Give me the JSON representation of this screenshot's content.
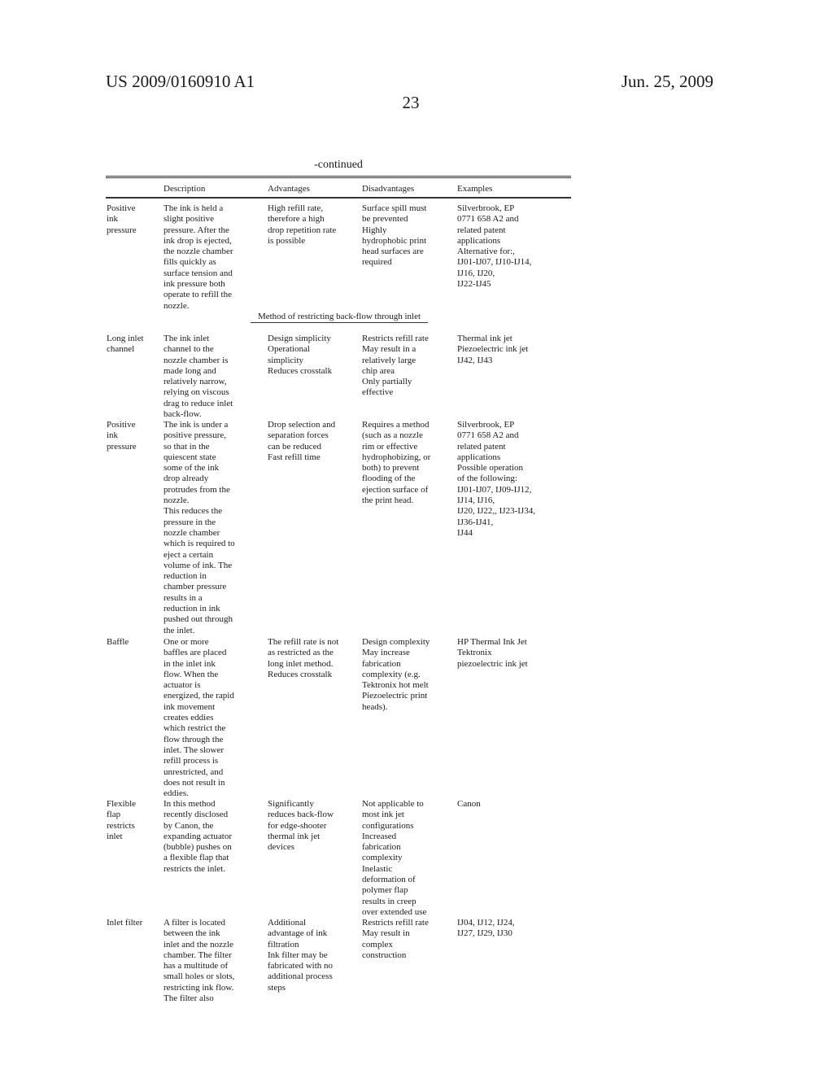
{
  "header": {
    "patent_number": "US 2009/0160910 A1",
    "date": "Jun. 25, 2009",
    "page_number": "23"
  },
  "table": {
    "continued_label": "-continued",
    "columns": [
      "",
      "Description",
      "Advantages",
      "Disadvantages",
      "Examples"
    ],
    "subheading": "Method of restricting back-flow through inlet",
    "rows": [
      {
        "name": "Positive\nink\npressure",
        "description": "The ink is held a\nslight positive\npressure. After the\nink drop is ejected,\nthe nozzle chamber\nfills quickly as\nsurface tension and\nink pressure both\noperate to refill the\nnozzle.",
        "advantages": "High refill rate,\ntherefore a high\ndrop repetition rate\nis possible",
        "disadvantages": "Surface spill must\nbe prevented\nHighly\nhydrophobic print\nhead surfaces are\nrequired",
        "examples": "Silverbrook, EP\n0771 658 A2 and\nrelated patent\napplications\nAlternative for:,\nIJ01-IJ07, IJ10-IJ14,\nIJ16, IJ20,\nIJ22-IJ45"
      },
      {
        "name": "Long inlet\nchannel",
        "description": "The ink inlet\nchannel to the\nnozzle chamber is\nmade long and\nrelatively narrow,\nrelying on viscous\ndrag to reduce inlet\nback-flow.",
        "advantages": "Design simplicity\nOperational\nsimplicity\nReduces crosstalk",
        "disadvantages": "Restricts refill rate\nMay result in a\nrelatively large\nchip area\nOnly partially\neffective",
        "examples": "Thermal ink jet\nPiezoelectric ink jet\nIJ42, IJ43"
      },
      {
        "name": "Positive\nink\npressure",
        "description": "The ink is under a\npositive pressure,\nso that in the\nquiescent state\nsome of the ink\ndrop already\nprotrudes from the\nnozzle.\nThis reduces the\npressure in the\nnozzle chamber\nwhich is required to\neject a certain\nvolume of ink. The\nreduction in\nchamber pressure\nresults in a\nreduction in ink\npushed out through\nthe inlet.",
        "advantages": "Drop selection and\nseparation forces\ncan be reduced\nFast refill time",
        "disadvantages": "Requires a method\n(such as a nozzle\nrim or effective\nhydrophobizing, or\nboth) to prevent\nflooding of the\nejection surface of\nthe print head.",
        "examples": "Silverbrook, EP\n0771 658 A2 and\nrelated patent\napplications\nPossible operation\nof the following:\nIJ01-IJ07, IJ09-IJ12,\nIJ14, IJ16,\nIJ20, IJ22,, IJ23-IJ34,\nIJ36-IJ41,\nIJ44"
      },
      {
        "name": "Baffle",
        "description": "One or more\nbaffles are placed\nin the inlet ink\nflow. When the\nactuator is\nenergized, the rapid\nink movement\ncreates eddies\nwhich restrict the\nflow through the\ninlet. The slower\nrefill process is\nunrestricted, and\ndoes not result in\neddies.",
        "advantages": "The refill rate is not\nas restricted as the\nlong inlet method.\nReduces crosstalk",
        "disadvantages": "Design complexity\nMay increase\nfabrication\ncomplexity (e.g.\nTektronix hot melt\nPiezoelectric print\nheads).",
        "examples": "HP Thermal Ink Jet\nTektronix\npiezoelectric ink jet"
      },
      {
        "name": "Flexible\nflap\nrestricts\ninlet",
        "description": "In this method\nrecently disclosed\nby Canon, the\nexpanding actuator\n(bubble) pushes on\na flexible flap that\nrestricts the inlet.",
        "advantages": "Significantly\nreduces back-flow\nfor edge-shooter\nthermal ink jet\ndevices",
        "disadvantages": "Not applicable to\nmost ink jet\nconfigurations\nIncreased\nfabrication\ncomplexity\nInelastic\ndeformation of\npolymer flap\nresults in creep\nover extended use",
        "examples": "Canon"
      },
      {
        "name": "Inlet filter",
        "description": "A filter is located\nbetween the ink\ninlet and the nozzle\nchamber. The filter\nhas a multitude of\nsmall holes or slots,\nrestricting ink flow.\nThe filter also",
        "advantages": "Additional\nadvantage of ink\nfiltration\nInk filter may be\nfabricated with no\nadditional process\nsteps",
        "disadvantages": "Restricts refill rate\nMay result in\ncomplex\nconstruction",
        "examples": "IJ04, IJ12, IJ24,\nIJ27, IJ29, IJ30"
      }
    ]
  }
}
